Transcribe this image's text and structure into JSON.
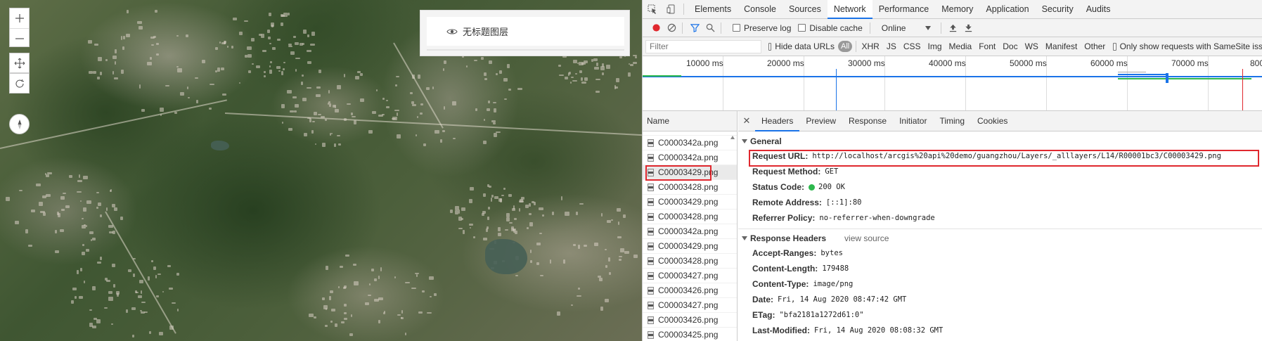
{
  "map": {
    "zoom_in_icon": "plus-icon",
    "zoom_out_icon": "minus-icon",
    "pan_icon": "move-icon",
    "rotate_icon": "rotate-icon",
    "compass_icon": "compass-icon",
    "layer_panel": {
      "visibility_icon": "eye-icon",
      "layer_name": "无标题图层"
    }
  },
  "devtools": {
    "main_tabs": [
      "Elements",
      "Console",
      "Sources",
      "Network",
      "Performance",
      "Memory",
      "Application",
      "Security",
      "Audits"
    ],
    "active_tab": "Network",
    "toolbar": {
      "preserve_log": "Preserve log",
      "disable_cache": "Disable cache",
      "throttle_value": "Online"
    },
    "filterbar": {
      "filter_placeholder": "Filter",
      "hide_data_urls": "Hide data URLs",
      "types": [
        "All",
        "XHR",
        "JS",
        "CSS",
        "Img",
        "Media",
        "Font",
        "Doc",
        "WS",
        "Manifest",
        "Other"
      ],
      "samesite_label": "Only show requests with SameSite iss"
    },
    "timeline": {
      "ticks": [
        "10000 ms",
        "20000 ms",
        "30000 ms",
        "40000 ms",
        "50000 ms",
        "60000 ms",
        "70000 ms",
        "800"
      ]
    },
    "name_column": {
      "header": "Name",
      "rows": [
        "C0000342a.png",
        "C0000342a.png",
        "C00003429.png",
        "C00003428.png",
        "C00003429.png",
        "C00003428.png",
        "C0000342a.png",
        "C00003429.png",
        "C00003428.png",
        "C00003427.png",
        "C00003426.png",
        "C00003427.png",
        "C00003426.png",
        "C00003425.png"
      ],
      "selected_index": 2
    },
    "detail": {
      "tabs": [
        "Headers",
        "Preview",
        "Response",
        "Initiator",
        "Timing",
        "Cookies"
      ],
      "active_tab": "Headers",
      "general": {
        "title": "General",
        "request_url_label": "Request URL:",
        "request_url": "http://localhost/arcgis%20api%20demo/guangzhou/Layers/_alllayers/L14/R00001bc3/C00003429.png",
        "request_method_label": "Request Method:",
        "request_method": "GET",
        "status_code_label": "Status Code:",
        "status_code": "200 OK",
        "status_color": "#2db84d",
        "remote_address_label": "Remote Address:",
        "remote_address": "[::1]:80",
        "referrer_policy_label": "Referrer Policy:",
        "referrer_policy": "no-referrer-when-downgrade"
      },
      "response_headers": {
        "title": "Response Headers",
        "view_source": "view source",
        "accept_ranges_label": "Accept-Ranges:",
        "accept_ranges": "bytes",
        "content_length_label": "Content-Length:",
        "content_length": "179488",
        "content_type_label": "Content-Type:",
        "content_type": "image/png",
        "date_label": "Date:",
        "date": "Fri, 14 Aug 2020 08:47:42 GMT",
        "etag_label": "ETag:",
        "etag": "\"bfa2181a1272d61:0\"",
        "last_modified_label": "Last-Modified:",
        "last_modified": "Fri, 14 Aug 2020 08:08:32 GMT"
      }
    },
    "highlight_color": "#e0282e",
    "accent_color": "#1a73e8"
  }
}
